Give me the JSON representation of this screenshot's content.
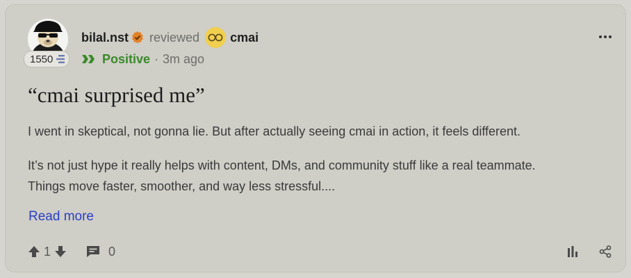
{
  "review": {
    "author": {
      "username": "bilal.nst",
      "score": "1550",
      "verified_icon": "verified-seal-icon"
    },
    "action": "reviewed",
    "brand": {
      "name": "cmai",
      "logo_icon": "sunglasses-icon"
    },
    "sentiment": {
      "label": "Positive",
      "color": "#3a8a2a",
      "icon": "double-chevron-icon"
    },
    "separator": "·",
    "time": "3m ago",
    "title": "“cmai surprised me”",
    "paragraphs": [
      "I went in skeptical, not gonna lie. But after actually seeing cmai in action, it feels different.",
      "It’s not just hype it really helps with content, DMs, and community stuff like a real teammate.",
      "Things move faster, smoother, and way less stressful...."
    ],
    "read_more": "Read more",
    "votes": "1",
    "comments": "0"
  },
  "colors": {
    "link": "#2a3fc4",
    "card_background": "#cfcec7",
    "positive": "#3a8a2a"
  }
}
